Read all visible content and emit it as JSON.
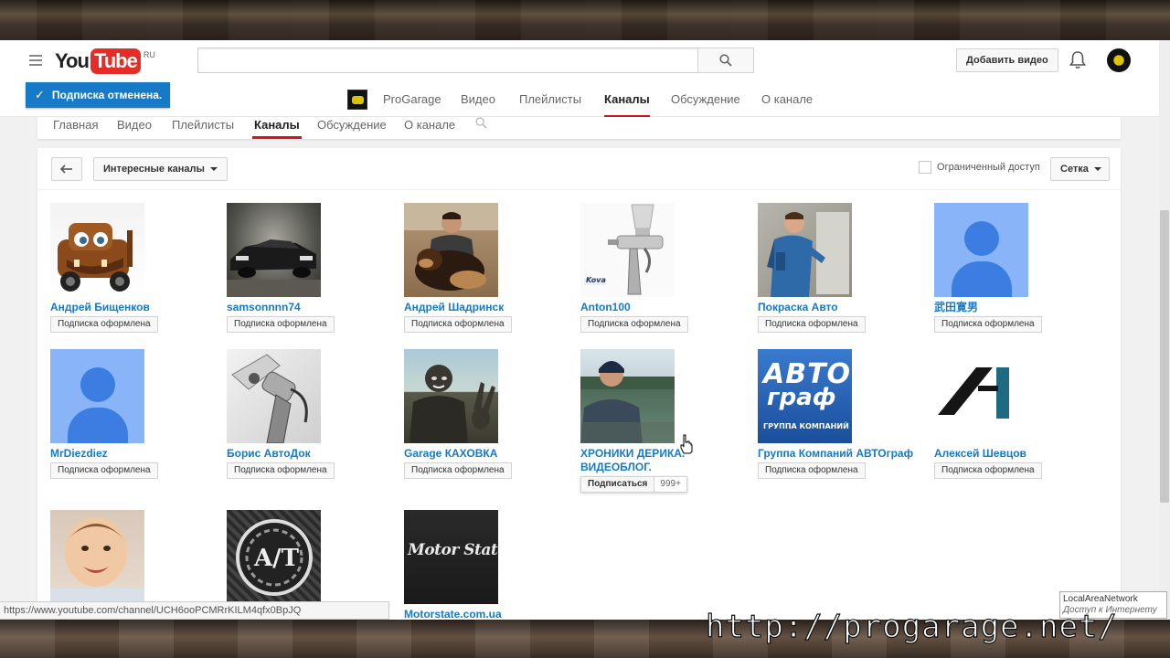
{
  "masthead": {
    "logo_you": "You",
    "logo_tube": "Tube",
    "region": "RU",
    "search_placeholder": "",
    "upload_label": "Добавить видео"
  },
  "toast": {
    "text": "Подписка отменена."
  },
  "guide_nav": {
    "channel": "ProGarage",
    "items": [
      "Видео",
      "Плейлисты",
      "Каналы",
      "Обсуждение",
      "О канале"
    ],
    "active": "Каналы"
  },
  "channel_tabs": {
    "items": [
      "Главная",
      "Видео",
      "Плейлисты",
      "Каналы",
      "Обсуждение",
      "О канале"
    ],
    "active": "Каналы"
  },
  "toolbar": {
    "dropdown_label": "Интересные каналы",
    "restricted_label": "Ограниченный доступ",
    "view_label": "Сетка"
  },
  "channels": [
    {
      "name": "Андрей Бищенков",
      "button": "Подписка оформлена"
    },
    {
      "name": "samsonnnn74",
      "button": "Подписка оформлена"
    },
    {
      "name": "Андрей Шадринск",
      "button": "Подписка оформлена"
    },
    {
      "name": "Anton100",
      "button": "Подписка оформлена"
    },
    {
      "name": "Покраска Авто",
      "button": "Подписка оформлена"
    },
    {
      "name": "武田寛男",
      "button": "Подписка оформлена"
    },
    {
      "name": "MrDiezdiez",
      "button": "Подписка оформлена"
    },
    {
      "name": "Борис АвтоДок",
      "button": "Подписка оформлена"
    },
    {
      "name": "Garage КАХОВКА",
      "button": "Подписка оформлена"
    },
    {
      "name": "ХРОНИКИ ДЕРИКА. ВИДЕОБЛОГ.",
      "button": "Подписаться",
      "count": "999+"
    },
    {
      "name": "Группа Компаний АВТОграф",
      "button": "Подписка оформлена"
    },
    {
      "name": "Алексей Шевцов",
      "button": "Подписка оформлена"
    },
    {
      "name": "",
      "button": ""
    },
    {
      "name": "",
      "button": ""
    },
    {
      "name": "Motorstate.com.ua",
      "button": ""
    }
  ],
  "thumb_text": {
    "avtograf_1": "АВТО",
    "avtograf_2": "граф",
    "avtograf_3": "ГРУППА КОМПАНИЙ",
    "motorstate": "Motor State",
    "at": "A/T",
    "anton": "Kova"
  },
  "status_url": "https://www.youtube.com/channel/UCH6ooPCMRrKILM4qfx0BpJQ",
  "network_tip": {
    "line1": "LocalAreaNetwork",
    "line2": "Доступ к Интернету"
  },
  "watermark": "http://progarage.net/",
  "colors": {
    "brand_red": "#e52d27",
    "link_blue": "#167ac6",
    "toast_blue": "#167ac6",
    "active_underline": "#cc181e"
  }
}
